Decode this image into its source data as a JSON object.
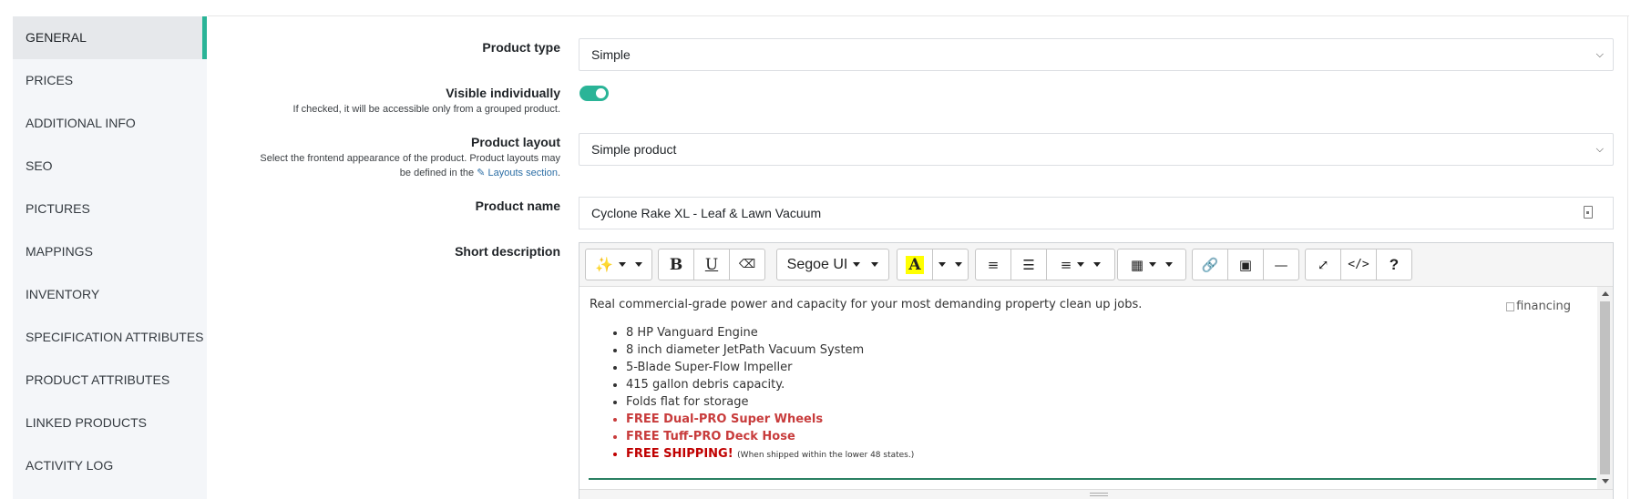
{
  "sidebar": {
    "items": [
      {
        "label": "GENERAL"
      },
      {
        "label": "PRICES"
      },
      {
        "label": "ADDITIONAL INFO"
      },
      {
        "label": "SEO"
      },
      {
        "label": "PICTURES"
      },
      {
        "label": "MAPPINGS"
      },
      {
        "label": "INVENTORY"
      },
      {
        "label": "SPECIFICATION ATTRIBUTES"
      },
      {
        "label": "PRODUCT ATTRIBUTES"
      },
      {
        "label": "LINKED PRODUCTS"
      },
      {
        "label": "ACTIVITY LOG"
      }
    ],
    "active_color": "#2ab497"
  },
  "form": {
    "product_type": {
      "label": "Product type",
      "value": "Simple"
    },
    "visible_individually": {
      "label": "Visible individually",
      "hint": "If checked, it will be accessible only from a grouped product.",
      "checked": true
    },
    "product_layout": {
      "label": "Product layout",
      "hint_line1": "Select the frontend appearance of the product. Product layouts may",
      "hint_line2_prefix": "be defined in the",
      "hint_link": "Layouts section",
      "hint_suffix": ".",
      "value": "Simple product"
    },
    "product_name": {
      "label": "Product name",
      "value": "Cyclone Rake XL - Leaf & Lawn Vacuum"
    },
    "short_description": {
      "label": "Short description"
    }
  },
  "editor": {
    "toolbar": {
      "font_name": "Segoe UI",
      "icons": [
        "magic-wand-icon",
        "bold-icon",
        "underline-icon",
        "eraser-icon",
        "highlight-icon",
        "unordered-list-icon",
        "ordered-list-icon",
        "align-icon",
        "table-icon",
        "link-icon",
        "image-icon",
        "horizontal-rule-icon",
        "fullscreen-icon",
        "code-view-icon",
        "help-icon"
      ],
      "bold": "B",
      "underline": "U",
      "highlight": "A",
      "code": "</>",
      "help": "?"
    },
    "content": {
      "intro": "Real commercial-grade power and capacity for your most demanding property clean up jobs.",
      "image_alt": "financing",
      "bullets": [
        "8 HP Vanguard Engine",
        "8 inch diameter JetPath Vacuum System",
        "5-Blade Super-Flow Impeller",
        "415 gallon debris capacity.",
        "Folds flat for storage"
      ],
      "red_bullets": [
        "FREE Dual-PRO Super Wheels",
        "FREE Tuff-PRO Deck Hose"
      ],
      "shipping_bold": "FREE SHIPPING!",
      "shipping_note": "(When shipped within the lower 48 states.)"
    }
  }
}
